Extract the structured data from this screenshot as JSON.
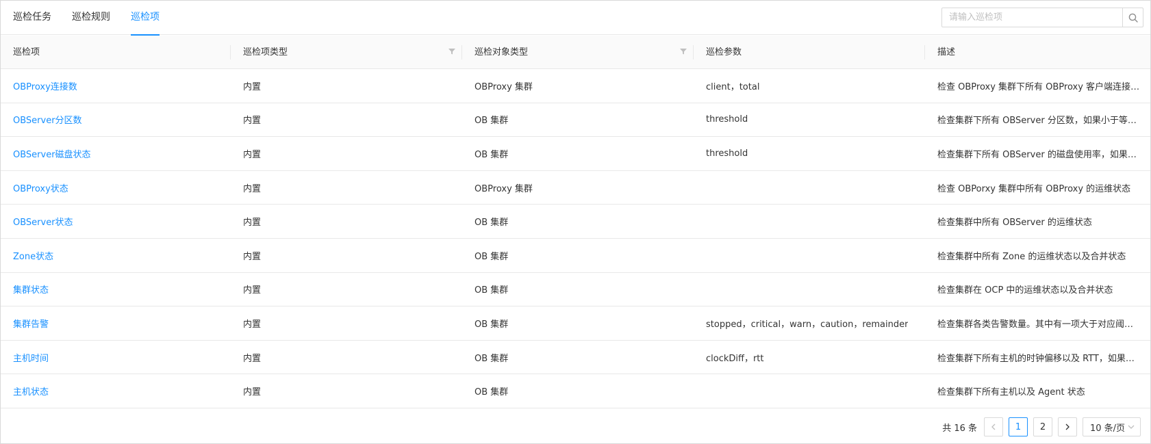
{
  "tabs": [
    {
      "label": "巡检任务",
      "active": false
    },
    {
      "label": "巡检规则",
      "active": false
    },
    {
      "label": "巡检项",
      "active": true
    }
  ],
  "search": {
    "placeholder": "请输入巡检项",
    "icon": "search-icon"
  },
  "table": {
    "columns": [
      "巡检项",
      "巡检项类型",
      "巡检对象类型",
      "巡检参数",
      "描述"
    ],
    "rows": [
      [
        "OBProxy连接数",
        "内置",
        "OBProxy 集群",
        "client，total",
        "检查 OBProxy 集群下所有 OBProxy 客户端连接数和..."
      ],
      [
        "OBServer分区数",
        "内置",
        "OB 集群",
        "threshold",
        "检查集群下所有 OBServer 分区数，如果小于等于阈..."
      ],
      [
        "OBServer磁盘状态",
        "内置",
        "OB 集群",
        "threshold",
        "检查集群下所有 OBServer 的磁盘使用率，如果小于..."
      ],
      [
        "OBProxy状态",
        "内置",
        "OBProxy 集群",
        "",
        "检查 OBPorxy 集群中所有 OBProxy 的运维状态"
      ],
      [
        "OBServer状态",
        "内置",
        "OB 集群",
        "",
        "检查集群中所有 OBServer 的运维状态"
      ],
      [
        "Zone状态",
        "内置",
        "OB 集群",
        "",
        "检查集群中所有 Zone 的运维状态以及合并状态"
      ],
      [
        "集群状态",
        "内置",
        "OB 集群",
        "",
        "检查集群在 OCP 中的运维状态以及合并状态"
      ],
      [
        "集群告警",
        "内置",
        "OB 集群",
        "stopped，critical，warn，caution，remainder",
        "检查集群各类告警数量。其中有一项大于对应阈值则..."
      ],
      [
        "主机时间",
        "内置",
        "OB 集群",
        "clockDiff，rtt",
        "检查集群下所有主机的时钟偏移以及 RTT，如果有一..."
      ],
      [
        "主机状态",
        "内置",
        "OB 集群",
        "",
        "检查集群下所有主机以及 Agent 状态"
      ]
    ]
  },
  "pagination": {
    "total_label": "共 16 条",
    "pages": [
      "1",
      "2"
    ],
    "current": "1",
    "page_size": "10 条/页"
  },
  "colors": {
    "accent": "#1890ff",
    "border": "#e8e8e8",
    "header_bg": "#fafafa"
  }
}
